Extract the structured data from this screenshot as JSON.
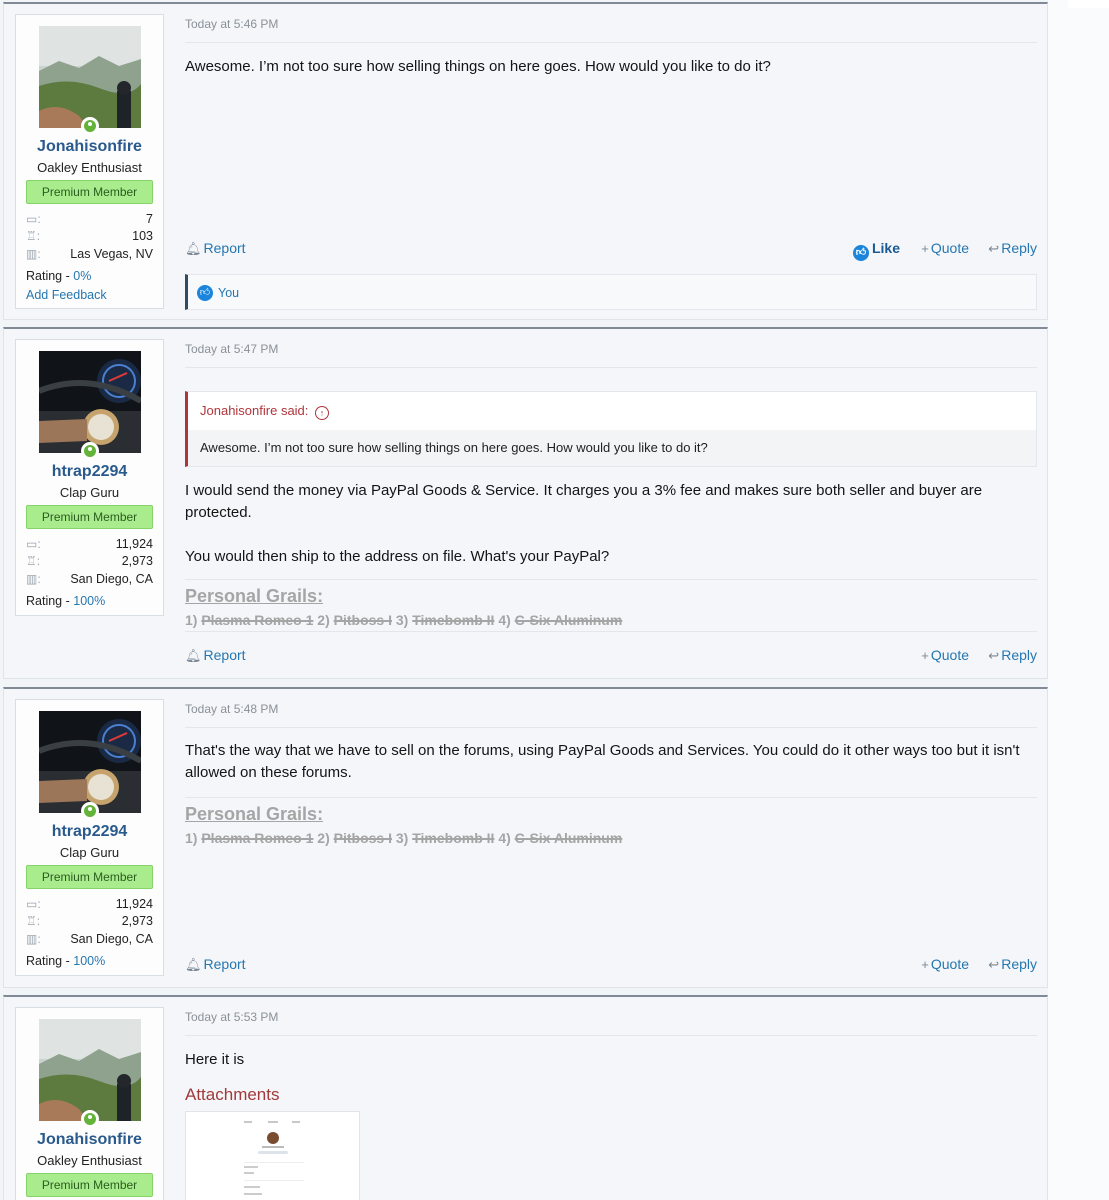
{
  "badge_label": "Premium Member",
  "actions": {
    "report": "Report",
    "like": "Like",
    "quote": "Quote",
    "reply": "Reply"
  },
  "posts": [
    {
      "user": {
        "name": "Jonahisonfire",
        "title": "Oakley Enthusiast",
        "messages": "7",
        "points": "103",
        "location": "Las Vegas, NV",
        "rating_label": "Rating",
        "rating_value": "0%",
        "feedback": "Add Feedback"
      },
      "date": "Today at 5:46 PM",
      "text": "Awesome. I’m not too sure how selling things on here goes. How would you like to do it?",
      "reactions": "You"
    },
    {
      "user": {
        "name": "htrap2294",
        "title": "Clap Guru",
        "messages": "11,924",
        "points": "2,973",
        "location": "San Diego, CA",
        "rating_label": "Rating",
        "rating_value": "100%"
      },
      "date": "Today at 5:47 PM",
      "quote_author": "Jonahisonfire said:",
      "quote_text": "Awesome. I’m not too sure how selling things on here goes. How would you like to do it?",
      "text1": "I would send the money via PayPal Goods & Service. It charges you a 3% fee and makes sure both seller and buyer are protected.",
      "text2": "You would then ship to the address on file. What's your PayPal?"
    },
    {
      "user": {
        "name": "htrap2294",
        "title": "Clap Guru",
        "messages": "11,924",
        "points": "2,973",
        "location": "San Diego, CA",
        "rating_label": "Rating",
        "rating_value": "100%"
      },
      "date": "Today at 5:48 PM",
      "text": "That's the way that we have to sell on the forums, using PayPal Goods and Services. You could do it other ways too but it isn't allowed on these forums."
    },
    {
      "user": {
        "name": "Jonahisonfire",
        "title": "Oakley Enthusiast"
      },
      "date": "Today at 5:53 PM",
      "text": "Here it is",
      "attachments_label": "Attachments"
    }
  ],
  "signature": {
    "title": "Personal Grails:",
    "n1": "1)",
    "g1": "Plasma Romeo 1",
    "n2": "2)",
    "g2": "Pitboss I",
    "n3": "3)",
    "g3": "Timebomb II",
    "n4": "4)",
    "g4": "C-Six Aluminum"
  },
  "icons": {
    "messages": "messages-icon",
    "trophy": "trophy-icon",
    "location": "map-icon",
    "report": "bell-icon",
    "quote": "plus-icon",
    "reply": "reply-arrow-icon",
    "like": "thumbs-up-icon",
    "quote_jump": "up-arrow-circle-icon"
  },
  "colors": {
    "accent": "#2577b1",
    "username": "#2a5a8c",
    "banner_bg": "#a9ec8e",
    "online": "#63b33a",
    "quote_border": "#b0353a",
    "like": "#1b85dc"
  }
}
